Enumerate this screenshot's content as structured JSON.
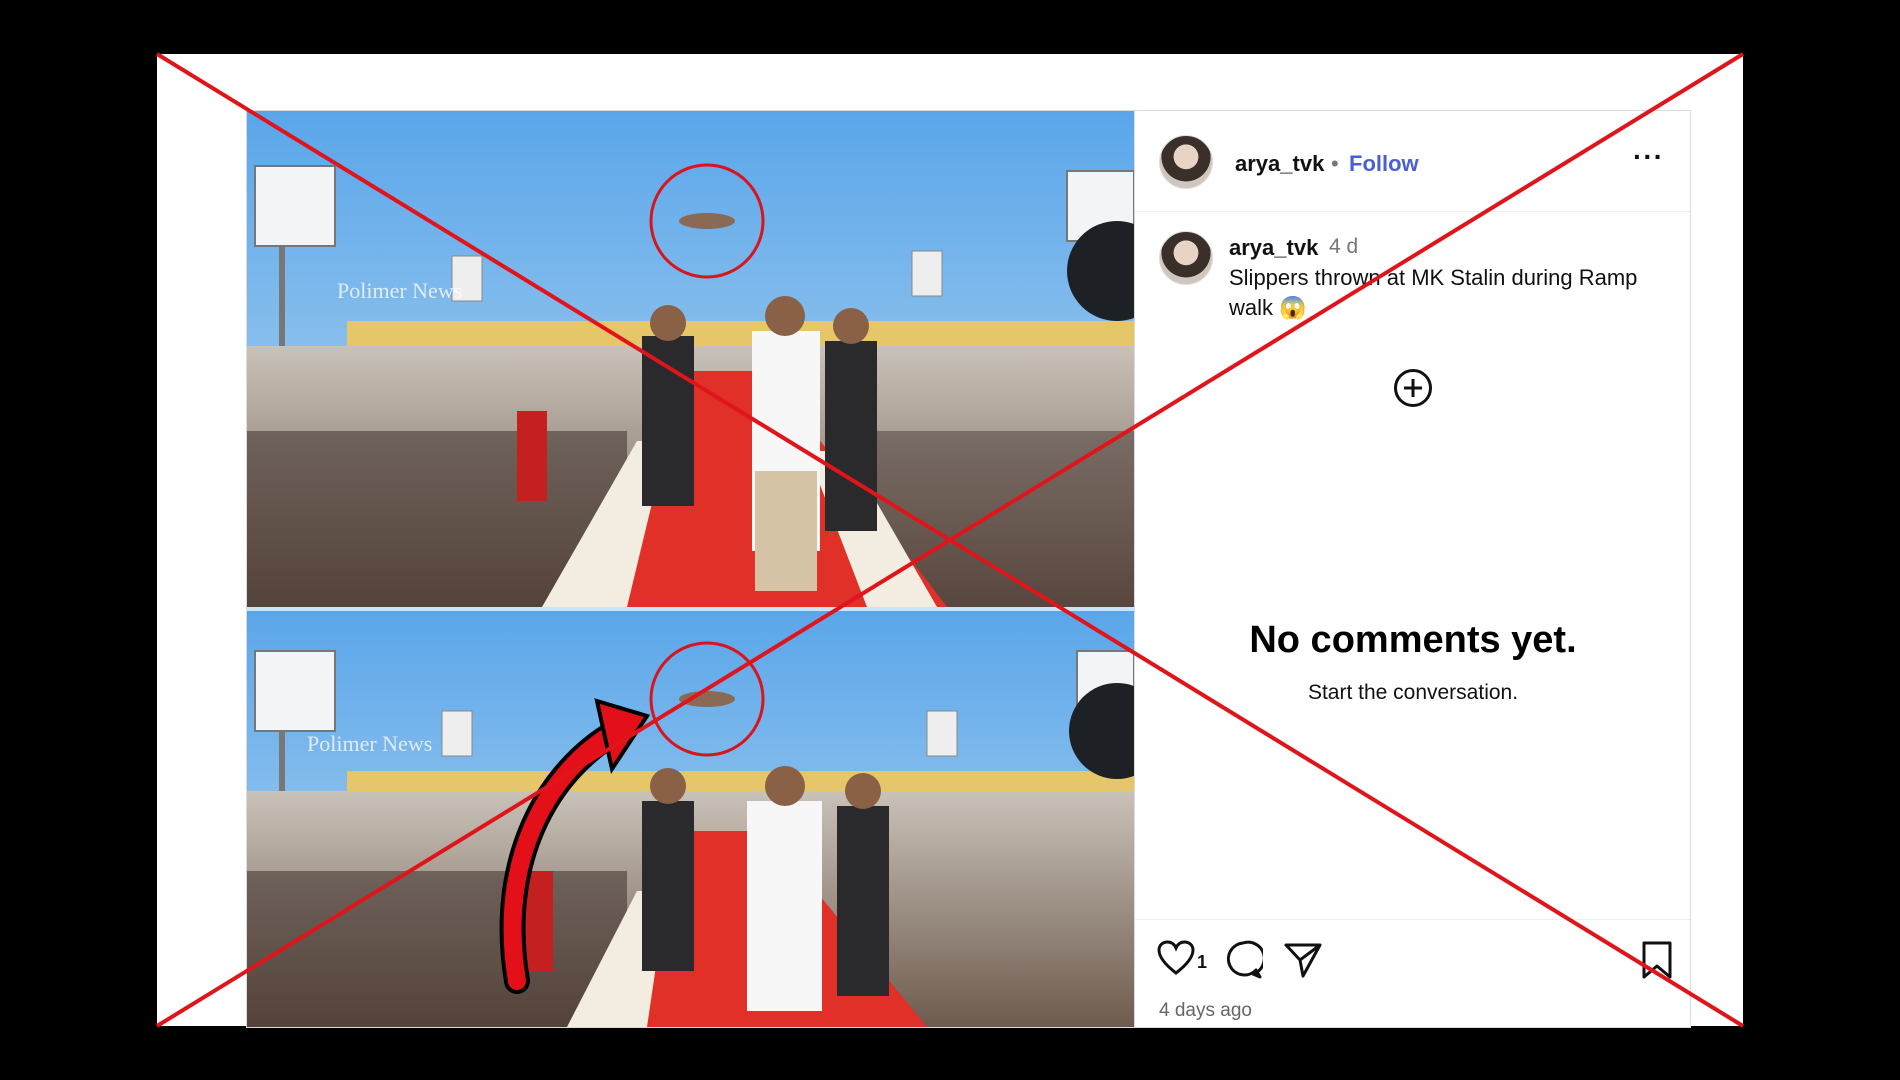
{
  "post": {
    "username": "arya_tvk",
    "follow_separator": "•",
    "follow_label": "Follow",
    "more_label": "···",
    "caption": {
      "username": "arya_tvk",
      "time": "4 d",
      "text": "Slippers thrown at MK Stalin during Ramp walk 😱"
    },
    "empty_state": {
      "title": "No comments yet.",
      "subtitle": "Start the conversation."
    },
    "like_count": "1",
    "post_age": "4 days ago"
  },
  "media": {
    "watermark": "Polimer News"
  },
  "colors": {
    "follow": "#4a5fd6",
    "cross": "#e0141b",
    "circle": "#d8141c",
    "arrow": "#e3101a"
  },
  "icons": [
    "more-icon",
    "add-circle-icon",
    "heart-icon",
    "comment-icon",
    "share-icon",
    "bookmark-icon"
  ]
}
